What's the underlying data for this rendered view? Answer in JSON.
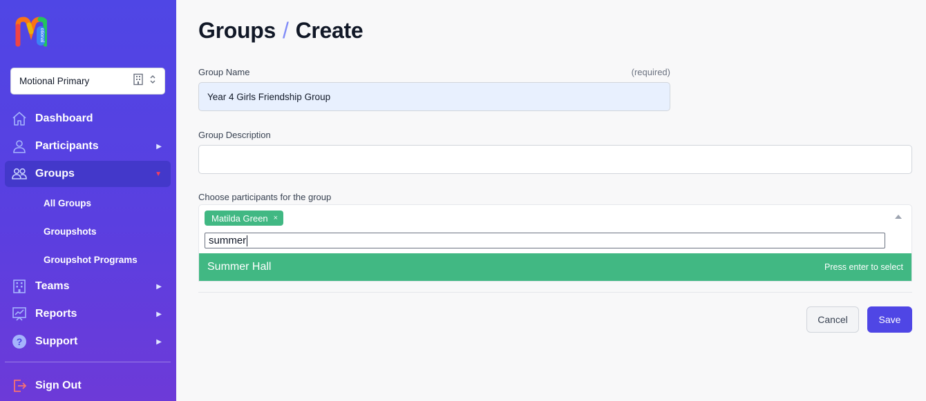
{
  "sidebar": {
    "logo_text": "otional",
    "school_selector": "Motional Primary",
    "nav": [
      {
        "label": "Dashboard",
        "icon": "home-icon"
      },
      {
        "label": "Participants",
        "icon": "user-icon"
      },
      {
        "label": "Groups",
        "icon": "users-icon"
      },
      {
        "label": "Teams",
        "icon": "building-icon"
      },
      {
        "label": "Reports",
        "icon": "chart-icon"
      },
      {
        "label": "Support",
        "icon": "question-icon"
      }
    ],
    "groups_sub": [
      "All Groups",
      "Groupshots",
      "Groupshot Programs"
    ],
    "sign_out": "Sign Out"
  },
  "page": {
    "breadcrumb_parent": "Groups",
    "breadcrumb_separator": "/",
    "breadcrumb_current": "Create"
  },
  "form": {
    "group_name_label": "Group Name",
    "group_name_required": "(required)",
    "group_name_value": "Year 4 Girls Friendship Group",
    "description_label": "Group Description",
    "description_value": "",
    "participants_label": "Choose participants for the group",
    "selected_tags": [
      "Matilda Green"
    ],
    "tag_remove": "×",
    "search_value": "summer",
    "option_name": "Summer Hall",
    "option_hint": "Press enter to select"
  },
  "actions": {
    "cancel": "Cancel",
    "save": "Save"
  },
  "colors": {
    "sidebar_top": "#4f46e5",
    "sidebar_bottom": "#6d3ad8",
    "accent_green": "#41b883",
    "primary_button": "#4f46e5",
    "active_caret": "#f43f5e"
  }
}
